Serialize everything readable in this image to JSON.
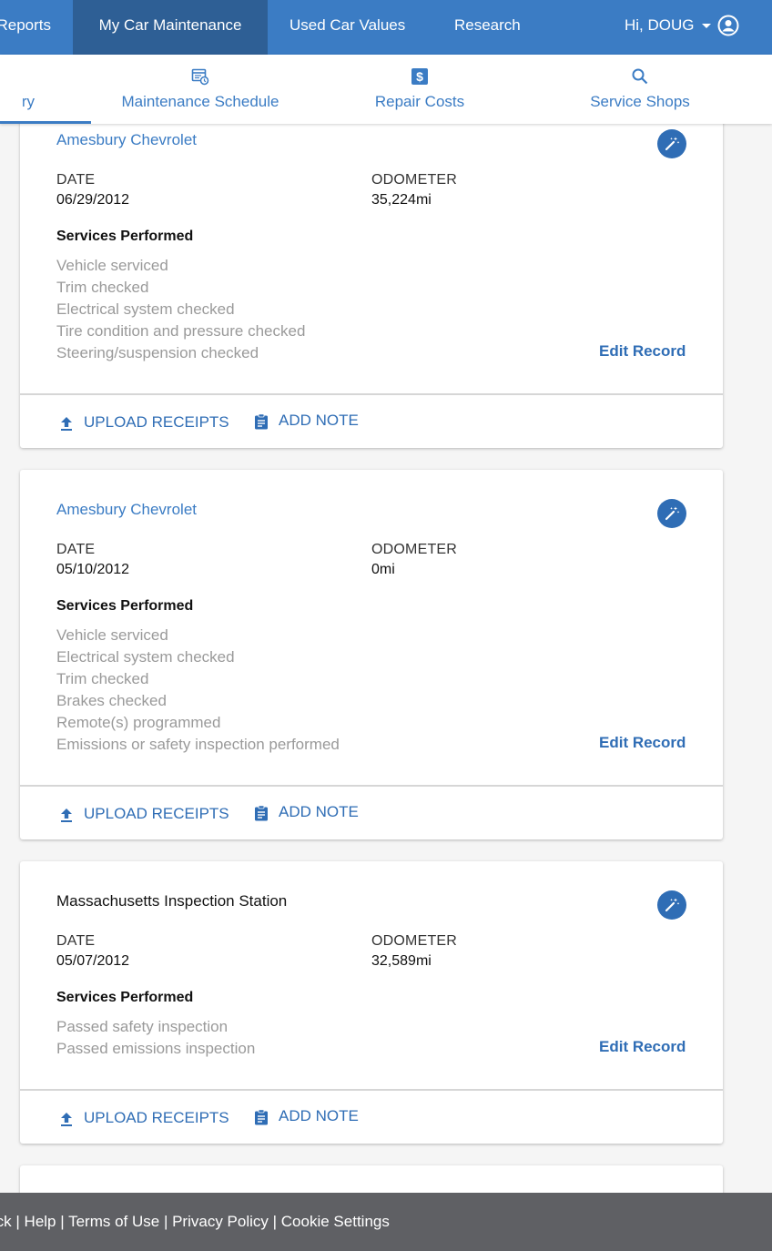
{
  "topnav": {
    "items": [
      {
        "label": "Reports",
        "active": false
      },
      {
        "label": "My Car Maintenance",
        "active": true
      },
      {
        "label": "Used Car Values",
        "active": false
      },
      {
        "label": "Research",
        "active": false
      }
    ],
    "user_greeting": "Hi, DOUG"
  },
  "subnav": {
    "tabs": [
      {
        "label": "History",
        "icon": "history-icon"
      },
      {
        "label": "Maintenance Schedule",
        "icon": "calendar-clock-icon"
      },
      {
        "label": "Repair Costs",
        "icon": "dollar-icon"
      },
      {
        "label": "Service Shops",
        "icon": "search-icon"
      }
    ]
  },
  "labels": {
    "date": "DATE",
    "odometer": "ODOMETER",
    "services_performed": "Services Performed",
    "edit_record": "Edit Record",
    "upload_receipts": "UPLOAD RECEIPTS",
    "add_note": "ADD NOTE"
  },
  "records": [
    {
      "shop": "Amesbury Chevrolet",
      "date": "06/29/2012",
      "odometer": "35,224mi",
      "services": [
        "Vehicle serviced",
        "Trim checked",
        "Electrical system checked",
        "Tire condition and pressure checked",
        "Steering/suspension checked"
      ]
    },
    {
      "shop": "Amesbury Chevrolet",
      "date": "05/10/2012",
      "odometer": "0mi",
      "services": [
        "Vehicle serviced",
        "Electrical system checked",
        "Trim checked",
        "Brakes checked",
        "Remote(s) programmed",
        "Emissions or safety inspection performed"
      ]
    },
    {
      "shop": "Massachusetts Inspection Station",
      "date": "05/07/2012",
      "odometer": "32,589mi",
      "services": [
        "Passed safety inspection",
        "Passed emissions inspection"
      ]
    }
  ],
  "footer": {
    "links": [
      "Feedback",
      "Help",
      "Terms of Use",
      "Privacy Policy",
      "Cookie Settings"
    ],
    "separator": " | "
  },
  "colors": {
    "brand_blue": "#3b7cc4",
    "active_nav": "#2e5f95",
    "footer_gray": "#5f6064"
  }
}
